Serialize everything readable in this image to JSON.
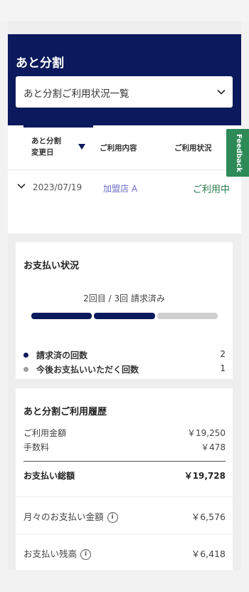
{
  "header": {
    "title": "あと分割"
  },
  "select": {
    "value": "あと分割ご利用状況一覧"
  },
  "table": {
    "columns": {
      "date_line1": "あと分割",
      "date_line2": "変更日",
      "content": "ご利用内容",
      "status": "ご利用状況"
    },
    "rows": [
      {
        "date": "2023/07/19",
        "shop": "加盟店 A",
        "status": "ご利用中"
      }
    ]
  },
  "feedback": {
    "label": "Feedback",
    "color": "#2e8b57"
  },
  "payment_status": {
    "title": "お支払い状況",
    "progress_text": "2回目 / 3回 請求済み",
    "progress": {
      "done": 2,
      "total": 3
    },
    "legend": [
      {
        "label": "請求済の回数",
        "value": "2",
        "color": "#0b1a5c"
      },
      {
        "label": "今後お支払いいただく回数",
        "value": "1",
        "color": "#9e9e9e"
      }
    ]
  },
  "history": {
    "title": "あと分割ご利用履歴",
    "usage_amount_label": "ご利用金額",
    "usage_amount": "￥19,250",
    "fee_label": "手数料",
    "fee": "￥478",
    "total_label": "お支払い総額",
    "total": "￥19,728",
    "monthly_label": "月々のお支払い金額",
    "monthly": "￥6,576",
    "balance_label": "お支払い残高",
    "balance": "￥6,418"
  },
  "colors": {
    "brand": "#0b1a5c",
    "status_green": "#2a7a4c",
    "link": "#6b6bc9"
  }
}
